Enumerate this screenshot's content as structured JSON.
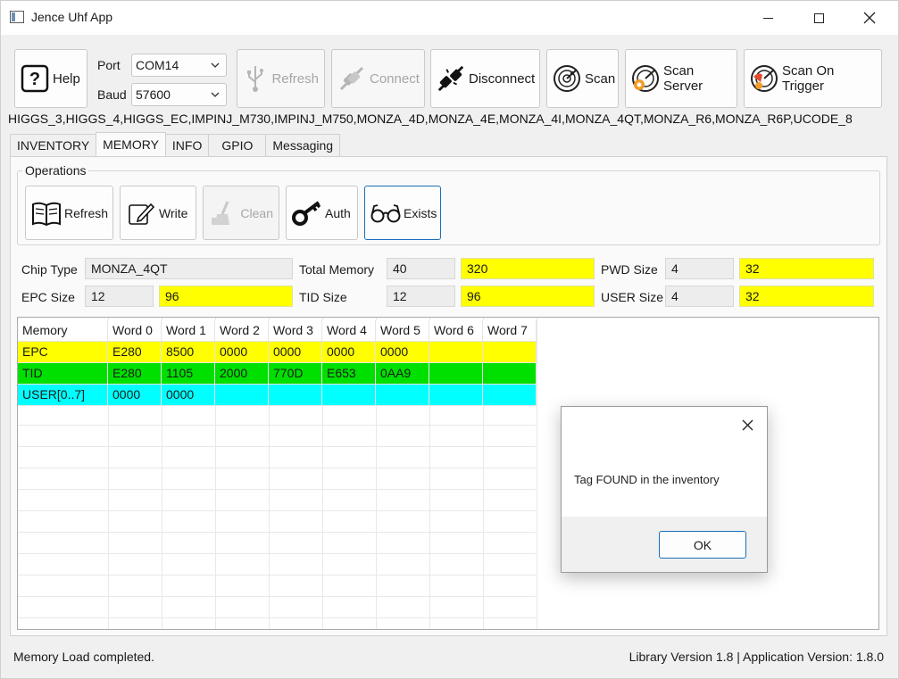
{
  "window": {
    "title": "Jence Uhf App"
  },
  "toolbar": {
    "help": "Help",
    "port_label": "Port",
    "port_value": "COM14",
    "baud_label": "Baud",
    "baud_value": "57600",
    "refresh": "Refresh",
    "connect": "Connect",
    "disconnect": "Disconnect",
    "scan": "Scan",
    "scan_server": "Scan Server",
    "scan_on_trigger": "Scan On Trigger"
  },
  "chip_list": "HIGGS_3,HIGGS_4,HIGGS_EC,IMPINJ_M730,IMPINJ_M750,MONZA_4D,MONZA_4E,MONZA_4I,MONZA_4QT,MONZA_R6,MONZA_R6P,UCODE_8",
  "tabs": [
    "INVENTORY",
    "MEMORY",
    "INFO",
    "GPIO",
    "Messaging"
  ],
  "operations": {
    "title": "Operations",
    "refresh": "Refresh",
    "write": "Write",
    "clean": "Clean",
    "auth": "Auth",
    "exists": "Exists"
  },
  "info": {
    "chip_type_label": "Chip Type",
    "chip_type": "MONZA_4QT",
    "total_memory_label": "Total Memory",
    "total_memory_words": "40",
    "total_memory_bits": "320",
    "pwd_size_label": "PWD Size",
    "pwd_words": "4",
    "pwd_bits": "32",
    "epc_size_label": "EPC Size",
    "epc_words": "12",
    "epc_bits": "96",
    "tid_size_label": "TID Size",
    "tid_words": "12",
    "tid_bits": "96",
    "user_size_label": "USER Size",
    "user_words": "4",
    "user_bits": "32"
  },
  "memory_table": {
    "headers": [
      "Memory",
      "Word 0",
      "Word 1",
      "Word 2",
      "Word 3",
      "Word 4",
      "Word 5",
      "Word 6",
      "Word 7"
    ],
    "rows": [
      {
        "name": "EPC",
        "color": "#ffff00",
        "words": [
          "E280",
          "8500",
          "0000",
          "0000",
          "0000",
          "0000",
          "",
          ""
        ]
      },
      {
        "name": "TID",
        "color": "#00e000",
        "words": [
          "E280",
          "1105",
          "2000",
          "770D",
          "E653",
          "0AA9",
          "",
          ""
        ]
      },
      {
        "name": "USER[0..7]",
        "color": "#00ffff",
        "words": [
          "0000",
          "0000",
          "",
          "",
          "",
          "",
          "",
          ""
        ]
      }
    ]
  },
  "dialog": {
    "message": "Tag FOUND in the inventory",
    "ok": "OK"
  },
  "status": {
    "left": "Memory Load completed.",
    "right": "Library Version 1.8 | Application Version: 1.8.0"
  },
  "icons": [
    "help-icon",
    "usb-icon",
    "plug-icon",
    "disconnect-plug-icon",
    "radar-icon",
    "book-icon",
    "pencil-icon",
    "broom-icon",
    "key-icon",
    "glasses-icon",
    "close-icon",
    "chevron-down-icon"
  ]
}
